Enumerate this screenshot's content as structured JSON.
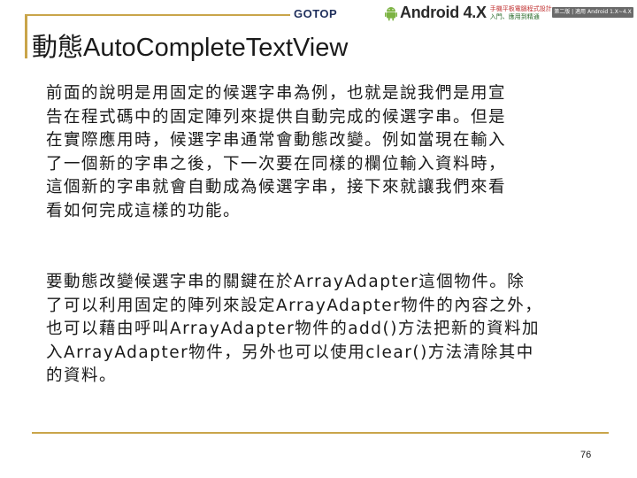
{
  "header": {
    "publisher_logo": "GOTOP",
    "product_logo": "Android 4.X",
    "product_subtitle_1": "手機平板電腦程式設計",
    "product_subtitle_2": "入門、應用到精通",
    "edition_tag": "第二版 | 適用 Android 1.X~4.X"
  },
  "title": "動態AutoCompleteTextView",
  "paragraph_1": [
    "前面的說明是用固定的候選字串為例，也就是說我們是用宣",
    "告在程式碼中的固定陣列來提供自動完成的候選字串。但是",
    "在實際應用時，候選字串通常會動態改變。例如當現在輸入",
    "了一個新的字串之後，下一次要在同樣的欄位輸入資料時，",
    "這個新的字串就會自動成為候選字串，接下來就讓我們來看",
    "看如何完成這樣的功能。"
  ],
  "paragraph_2": [
    "要動態改變候選字串的關鍵在於ArrayAdapter這個物件。除",
    "了可以利用固定的陣列來設定ArrayAdapter物件的內容之外，",
    "也可以藉由呼叫ArrayAdapter物件的add()方法把新的資料加",
    "入ArrayAdapter物件，另外也可以使用clear()方法清除其中",
    "的資料。"
  ],
  "page_number": "76",
  "colors": {
    "accent_rule": "#c9a54a",
    "publisher_logo": "#1f2f5c",
    "android_green": "#7cb342"
  },
  "icons": {
    "android_robot": "android-robot-icon"
  }
}
